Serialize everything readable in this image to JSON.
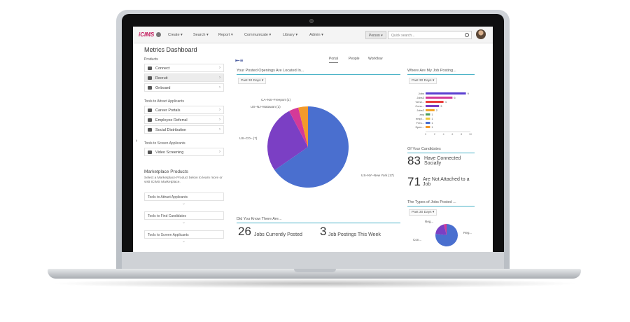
{
  "header": {
    "logo": "iCIMS",
    "nav": [
      "Create ▾",
      "Search ▾",
      "Report ▾",
      "Communicate ▾",
      "Library ▾",
      "Admin ▾"
    ],
    "person_select": "Person ▾",
    "search_placeholder": "Quick search..."
  },
  "sidebar": {
    "title": "Metrics Dashboard",
    "products_label": "Products",
    "products": [
      {
        "label": "Connect",
        "icon": "flame-icon"
      },
      {
        "label": "Recruit",
        "icon": "briefcase-icon"
      },
      {
        "label": "Onboard",
        "icon": "card-icon"
      }
    ],
    "attract_label": "Tools to Attract Applicants",
    "attract": [
      {
        "label": "Career Portals",
        "icon": "pen-icon"
      },
      {
        "label": "Employee Referral",
        "icon": "people-icon"
      },
      {
        "label": "Social Distribution",
        "icon": "share-icon"
      }
    ],
    "screen_label": "Tools to Screen Applicants",
    "screen": [
      {
        "label": "Video Screening",
        "icon": "video-icon"
      }
    ],
    "marketplace": {
      "title": "Marketplace Products",
      "text": "Select a Marketplace Product below to learn more or visit ICIMS Marketplace.",
      "items": [
        "Tools to Attract Applicants",
        "Tools to Find Candidates",
        "Tools to Screen Applicants"
      ]
    }
  },
  "tabs": [
    "Portal",
    "People",
    "Workflow"
  ],
  "openings": {
    "title": "Your Posted Openings Are Located In...",
    "range": "Past 30 Days ▾",
    "labels": {
      "freeport": "CA–NS–Freeport (1)",
      "matawan": "US–NJ–Matawan (1)",
      "co": "US–CO– (7)",
      "ny": "US–NY–New York (17)"
    }
  },
  "did_you_know": {
    "title": "Did You Know There Are...",
    "jobs_posted_num": "26",
    "jobs_posted_lbl": "Jobs Currently Posted",
    "week_num": "3",
    "week_lbl": "Job Postings This Week"
  },
  "where_posting": {
    "title": "Where Are My Job Posting...",
    "range": "Past 30 Days ▾"
  },
  "candidates": {
    "title": "Of Your Candidates",
    "connected_num": "83",
    "connected_lbl": "Have Connected Socially",
    "not_attached_num": "71",
    "not_attached_lbl": "Are Not Attached to a Job"
  },
  "job_types": {
    "title": "The Types of Jobs Posted ...",
    "range": "Past 30 Days ▾",
    "labels": {
      "reg1": "Reg...",
      "con": "Con...",
      "reg2": "Reg..."
    }
  },
  "chart_data": [
    {
      "type": "pie",
      "title": "Your Posted Openings Are Located In...",
      "slices": [
        {
          "label": "US–NY–New York",
          "value": 17,
          "color": "#4a6fcf"
        },
        {
          "label": "US–CO–",
          "value": 7,
          "color": "#7b3fc4"
        },
        {
          "label": "US–NJ–Matawan",
          "value": 1,
          "color": "#d43a98"
        },
        {
          "label": "CA–NS–Freeport",
          "value": 1,
          "color": "#f39a2b"
        }
      ]
    },
    {
      "type": "bar",
      "title": "Where Are My Job Posting...",
      "categories": [
        "Jobs",
        "Jobs3",
        "Vend...",
        "Cons...",
        "Jobs2",
        "any",
        "empl...",
        "Fres...",
        "Spen..."
      ],
      "values": [
        9,
        6,
        4,
        3,
        2,
        1,
        1,
        1,
        1
      ],
      "colors": [
        "#5a3fd1",
        "#d43a98",
        "#e83e3e",
        "#7b3fc4",
        "#f3a62b",
        "#4a9e5c",
        "#f0c93a",
        "#4a6fcf",
        "#f39a2b"
      ],
      "xticks": [
        "0",
        "2",
        "4",
        "6",
        "8",
        "10"
      ],
      "xlim": [
        0,
        10
      ]
    },
    {
      "type": "pie",
      "title": "The Types of Jobs Posted ...",
      "slices": [
        {
          "label": "Reg...",
          "value": 20,
          "color": "#4a6fcf"
        },
        {
          "label": "Con...",
          "value": 5,
          "color": "#7b3fc4"
        },
        {
          "label": "Reg...",
          "value": 1,
          "color": "#d43a98"
        }
      ]
    }
  ]
}
